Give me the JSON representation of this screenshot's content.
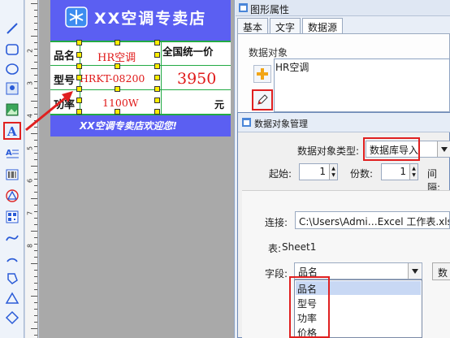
{
  "label": {
    "title": "XX空调专卖店",
    "row1_key": "品名",
    "row1_val": "HR空调",
    "row1_right": "全国统一价",
    "row2_key": "型号",
    "row2_val": "HRKT-08200",
    "row2_right": "3950",
    "row3_key": "功率",
    "row3_val": "1100W",
    "row3_right": "元",
    "footer": "XX空调专卖店欢迎您!"
  },
  "ruler": {
    "n1": "2",
    "n2": "3",
    "n3": "4",
    "n4": "5",
    "n5": "6",
    "n6": "7",
    "n7": "8"
  },
  "props": {
    "title": "图形属性",
    "tabs": [
      "基本",
      "文字",
      "数据源"
    ],
    "group_label": "数据对象",
    "list_item": "HR空调"
  },
  "dialog": {
    "title": "数据对象管理",
    "type_label": "数据对象类型:",
    "type_value": "数据库导入",
    "start_label": "起始:",
    "start_value": "1",
    "copies_label": "份数:",
    "copies_value": "1",
    "interval_label": "间隔:",
    "conn_label": "连接:",
    "conn_value": "C:\\Users\\Admi…Excel 工作表.xls",
    "table_label": "表:",
    "table_value": "Sheet1",
    "field_label": "字段:",
    "field_value": "品名",
    "field_button": "数",
    "field_options": [
      "品名",
      "型号",
      "功率",
      "价格"
    ]
  },
  "colors": {
    "label_bg": "#5b5ff2",
    "accent_red": "#e02020",
    "text_red": "#e01818"
  }
}
